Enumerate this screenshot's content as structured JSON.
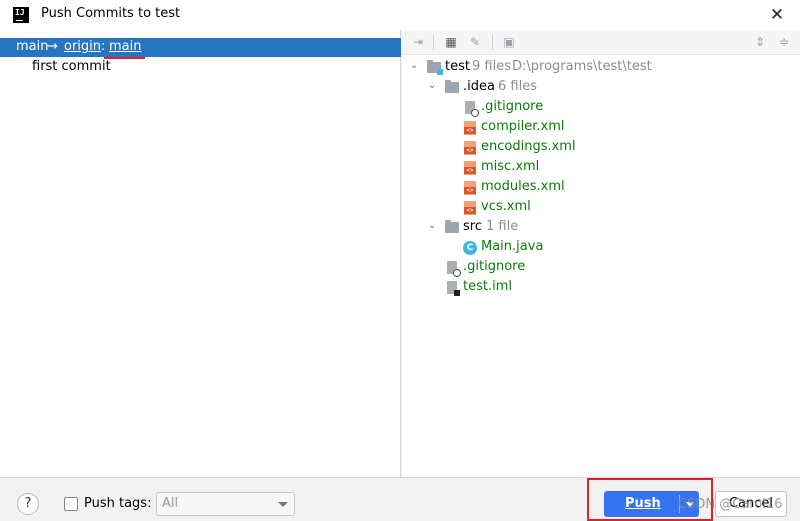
{
  "window": {
    "title": "Push Commits to test",
    "app_icon": "IJ"
  },
  "left": {
    "branch": {
      "local": "main",
      "arrow": "→",
      "remote": "origin",
      "separator": ":",
      "target": "main"
    },
    "commits": [
      "first commit"
    ]
  },
  "toolbar": {
    "icons": [
      "collapse-icon",
      "group-by-icon",
      "edit-icon",
      "preview-icon",
      "expand-all-icon",
      "collapse-all-icon"
    ]
  },
  "tree": {
    "root": {
      "name": "test",
      "count": "9 files",
      "path": "D:\\programs\\test\\test"
    },
    "idea": {
      "name": ".idea",
      "count": "6 files"
    },
    "idea_files": [
      ".gitignore",
      "compiler.xml",
      "encodings.xml",
      "misc.xml",
      "modules.xml",
      "vcs.xml"
    ],
    "src": {
      "name": "src",
      "count": "1 file"
    },
    "src_files": [
      "Main.java"
    ],
    "root_files": [
      ".gitignore",
      "test.iml"
    ]
  },
  "bottom": {
    "help": "?",
    "push_tags_label": "Push tags:",
    "tags_value": "All",
    "push_label": "Push",
    "cancel_label": "Cancel",
    "watermark": "CSDN @Carol16"
  },
  "colors": {
    "selection": "#2675bf",
    "primary_button": "#3574f0",
    "added_file": "#0b7a0b",
    "highlight": "#e0202a"
  }
}
